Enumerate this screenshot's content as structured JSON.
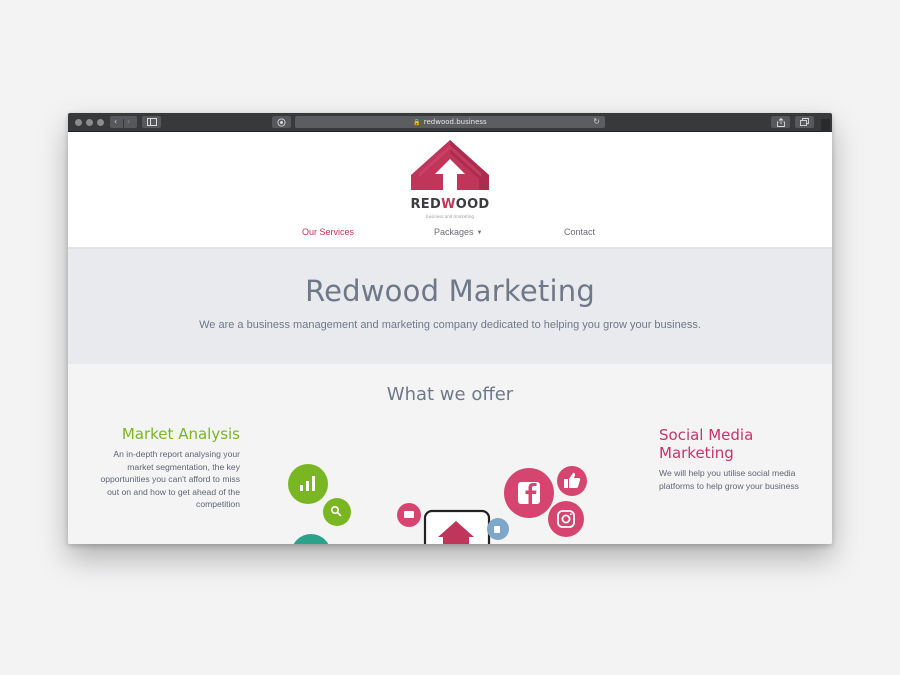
{
  "browser": {
    "url": "redwood.business",
    "nav_back": "‹",
    "nav_forward": "›",
    "reload_glyph": "↻"
  },
  "brand": {
    "name_prefix": "RED",
    "name_accent": "W",
    "name_suffix": "OOD",
    "tagline": "business and marketing",
    "color_primary": "#c0365a"
  },
  "nav": {
    "items": [
      {
        "label": "Our Services",
        "active": true
      },
      {
        "label": "Packages",
        "has_dropdown": true
      },
      {
        "label": "Contact"
      }
    ]
  },
  "hero": {
    "title": "Redwood Marketing",
    "subtitle": "We are a business management and marketing company dedicated to helping you grow your business."
  },
  "offer": {
    "title": "What we offer",
    "services": [
      {
        "title": "Market Analysis",
        "text": "An in-depth report analysing your market segmentation, the key opportunities you can't afford to miss out on and how to get ahead of the competition",
        "color": "#7ab621"
      },
      {
        "title": "Social Media Marketing",
        "text": "We will help you utilise social media platforms to help grow your business",
        "color": "#c9336a"
      }
    ]
  },
  "illustration_icons": [
    "bar-chart-icon",
    "search-icon",
    "chat-bubble-icon",
    "phone-icon",
    "facebook-icon",
    "thumbs-up-icon",
    "instagram-icon"
  ]
}
